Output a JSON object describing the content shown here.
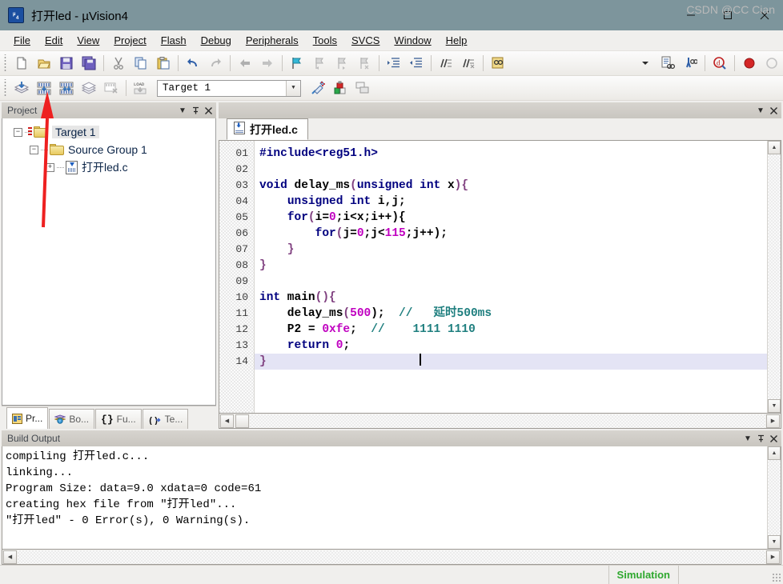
{
  "window": {
    "title": "打开led  - µVision4",
    "app_icon": "uvision-logo-icon",
    "minimize": "–",
    "maximize": "☐",
    "close": "✕"
  },
  "menubar": {
    "items": [
      {
        "label": "File",
        "accel": "F"
      },
      {
        "label": "Edit",
        "accel": "E"
      },
      {
        "label": "View",
        "accel": "V"
      },
      {
        "label": "Project",
        "accel": "P"
      },
      {
        "label": "Flash",
        "accel": "a"
      },
      {
        "label": "Debug",
        "accel": "D"
      },
      {
        "label": "Peripherals",
        "accel": "i"
      },
      {
        "label": "Tools",
        "accel": "T"
      },
      {
        "label": "SVCS",
        "accel": "S"
      },
      {
        "label": "Window",
        "accel": "W"
      },
      {
        "label": "Help",
        "accel": "H"
      }
    ]
  },
  "toolbar_main": {
    "buttons": [
      "new-file-icon",
      "open-file-icon",
      "save-icon",
      "save-all-icon",
      "cut-icon",
      "copy-icon",
      "paste-icon",
      "undo-icon",
      "redo-icon",
      "navigate-back-icon",
      "navigate-forward-icon",
      "bookmark-toggle-icon",
      "bookmark-prev-icon",
      "bookmark-next-icon",
      "bookmark-clear-icon",
      "indent-increase-icon",
      "indent-decrease-icon",
      "comment-lines-icon",
      "uncomment-lines-icon",
      "find-in-files-icon"
    ],
    "right_buttons": [
      "toolbox-dropdown-icon",
      "text-find-icon",
      "find-binoculars-icon",
      "debug-search-icon",
      "record-icon",
      "stop-icon"
    ]
  },
  "toolbar_build": {
    "buttons": [
      "translate-file-icon",
      "build-target-icon",
      "rebuild-all-icon",
      "batch-build-icon",
      "stop-build-icon",
      "download-load-icon"
    ],
    "target_value": "Target 1",
    "dropdown_glyph": "▼",
    "right_buttons": [
      "options-target-icon",
      "manage-components-icon",
      "multi-project-icon"
    ]
  },
  "project_panel": {
    "title": "Project",
    "header_buttons": [
      "dropdown-icon",
      "pin-icon",
      "close-icon"
    ],
    "pin_glyph": "⊤",
    "close_glyph": "✕",
    "dropdown_glyph": "▼",
    "tree": {
      "target": {
        "label": "Target 1",
        "expander": "−"
      },
      "group": {
        "label": "Source Group 1",
        "expander": "−"
      },
      "file": {
        "label": "打开led.c",
        "expander": "+"
      }
    },
    "tabs": [
      {
        "label": "Pr...",
        "icon": "project-window-icon",
        "active": true
      },
      {
        "label": "Bo...",
        "icon": "books-icon",
        "active": false
      },
      {
        "label": "Fu...",
        "icon": "functions-braces-icon",
        "active": false
      },
      {
        "label": "Te...",
        "icon": "templates-icon",
        "active": false
      }
    ],
    "tab_icon_text": {
      "functions": "{}",
      "templates": "0,"
    }
  },
  "editor": {
    "header_buttons": [
      "dropdown-icon",
      "close-icon"
    ],
    "dropdown_glyph": "▼",
    "close_glyph": "✕",
    "tab": {
      "label": "打开led.c",
      "icon": "c-source-file-icon"
    },
    "line_numbers": [
      "01",
      "02",
      "03",
      "04",
      "05",
      "06",
      "07",
      "08",
      "09",
      "10",
      "11",
      "12",
      "13",
      "14"
    ],
    "current_line": 14,
    "lines": [
      {
        "n": "01",
        "tokens": [
          {
            "t": "#include<reg51.h>",
            "c": "pre"
          }
        ]
      },
      {
        "n": "02",
        "tokens": []
      },
      {
        "n": "03",
        "tokens": [
          {
            "t": "void",
            "c": "kw"
          },
          {
            "t": " delay_ms",
            "c": "plain"
          },
          {
            "t": "(",
            "c": "pun"
          },
          {
            "t": "unsigned int",
            "c": "kw"
          },
          {
            "t": " x",
            "c": "plain"
          },
          {
            "t": "){",
            "c": "pun"
          }
        ]
      },
      {
        "n": "04",
        "tokens": [
          {
            "t": "    ",
            "c": "plain"
          },
          {
            "t": "unsigned int",
            "c": "kw"
          },
          {
            "t": " i,j;",
            "c": "plain"
          }
        ]
      },
      {
        "n": "05",
        "tokens": [
          {
            "t": "    ",
            "c": "plain"
          },
          {
            "t": "for",
            "c": "kw"
          },
          {
            "t": "(",
            "c": "pun"
          },
          {
            "t": "i=",
            "c": "plain"
          },
          {
            "t": "0",
            "c": "num"
          },
          {
            "t": ";i<x;i++){",
            "c": "plain"
          }
        ]
      },
      {
        "n": "06",
        "tokens": [
          {
            "t": "        ",
            "c": "plain"
          },
          {
            "t": "for",
            "c": "kw"
          },
          {
            "t": "(",
            "c": "pun"
          },
          {
            "t": "j=",
            "c": "plain"
          },
          {
            "t": "0",
            "c": "num"
          },
          {
            "t": ";j<",
            "c": "plain"
          },
          {
            "t": "115",
            "c": "num"
          },
          {
            "t": ";j++);",
            "c": "plain"
          }
        ]
      },
      {
        "n": "07",
        "tokens": [
          {
            "t": "    }",
            "c": "pun"
          }
        ]
      },
      {
        "n": "08",
        "tokens": [
          {
            "t": "}",
            "c": "pun"
          }
        ]
      },
      {
        "n": "09",
        "tokens": []
      },
      {
        "n": "10",
        "tokens": [
          {
            "t": "int",
            "c": "kw"
          },
          {
            "t": " main",
            "c": "plain"
          },
          {
            "t": "(){",
            "c": "pun"
          }
        ]
      },
      {
        "n": "11",
        "tokens": [
          {
            "t": "    delay_ms",
            "c": "plain"
          },
          {
            "t": "(",
            "c": "pun"
          },
          {
            "t": "500",
            "c": "num"
          },
          {
            "t": "); ",
            "c": "plain"
          },
          {
            "t": " //   延时500ms",
            "c": "cmt"
          }
        ]
      },
      {
        "n": "12",
        "tokens": [
          {
            "t": "    P2 = ",
            "c": "plain"
          },
          {
            "t": "0xfe",
            "c": "num"
          },
          {
            "t": "; ",
            "c": "plain"
          },
          {
            "t": " //    1111 1110",
            "c": "cmt"
          }
        ]
      },
      {
        "n": "13",
        "tokens": [
          {
            "t": "    ",
            "c": "plain"
          },
          {
            "t": "return",
            "c": "kw"
          },
          {
            "t": " ",
            "c": "plain"
          },
          {
            "t": "0",
            "c": "num"
          },
          {
            "t": ";",
            "c": "plain"
          }
        ]
      },
      {
        "n": "14",
        "tokens": [
          {
            "t": "}",
            "c": "pun"
          }
        ]
      }
    ],
    "code_colors": {
      "preprocessor": "#00007f",
      "keyword": "#00007f",
      "number": "#c000c0",
      "comment": "#1f7f7f",
      "punctuation": "#7f3f7f",
      "current_line_bg": "#e4e4f5"
    }
  },
  "build_output": {
    "title": "Build Output",
    "header_buttons": [
      "dropdown-icon",
      "pin-icon",
      "close-icon"
    ],
    "dropdown_glyph": "▼",
    "pin_glyph": "⊤",
    "close_glyph": "✕",
    "lines": [
      "compiling 打开led.c...",
      "linking...",
      "Program Size: data=9.0 xdata=0 code=61",
      "creating hex file from \"打开led\"...",
      "\"打开led\" - 0 Error(s), 0 Warning(s)."
    ]
  },
  "statusbar": {
    "simulation_label": "Simulation",
    "simulation_color": "#2fa82f",
    "watermark": "CSDN @CC Cian"
  },
  "annotation": {
    "arrow_color": "#ee2020",
    "points_to": "build-target-icon"
  }
}
